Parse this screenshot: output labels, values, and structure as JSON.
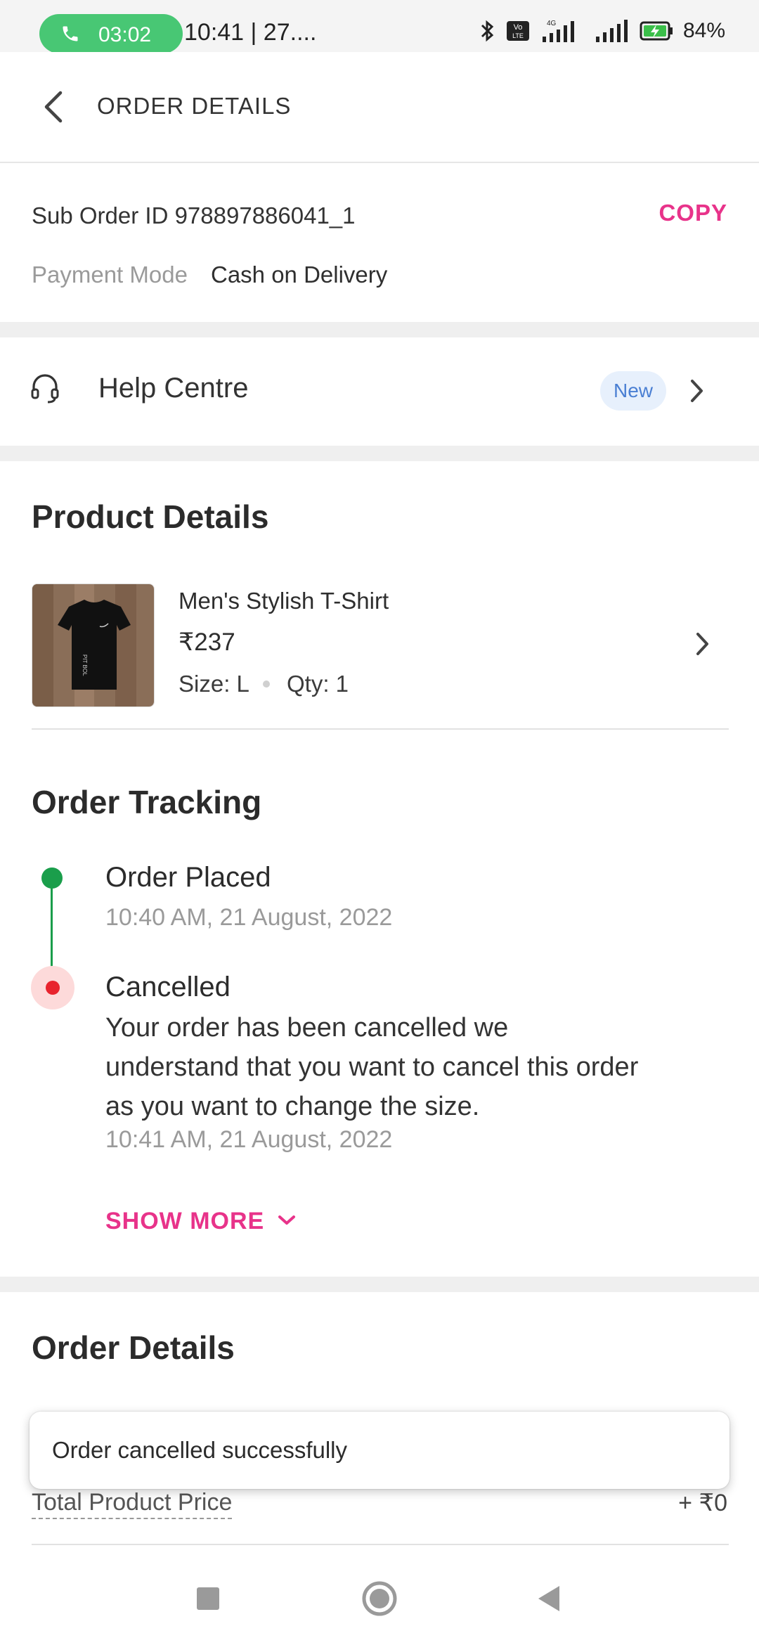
{
  "status_bar": {
    "call_timer": "03:02",
    "time_date": "10:41 | 27....",
    "battery": "84"
  },
  "header": {
    "title": "ORDER DETAILS"
  },
  "suborder": {
    "id_text": "Sub Order ID 978897886041_1",
    "copy_label": "COPY",
    "payment_label": "Payment Mode",
    "payment_value": "Cash on Delivery"
  },
  "help": {
    "label": "Help Centre",
    "badge": "New"
  },
  "product": {
    "heading": "Product Details",
    "name": "Men's Stylish T-Shirt",
    "price": "₹237",
    "size": "Size: L",
    "qty": "Qty: 1"
  },
  "tracking": {
    "heading": "Order Tracking",
    "steps": [
      {
        "title": "Order Placed",
        "time": "10:40 AM, 21 August, 2022"
      },
      {
        "title": "Cancelled",
        "description": "Your order has been cancelled we understand that you want to cancel this order as you want to change the size.",
        "time": "10:41 AM, 21 August, 2022"
      }
    ],
    "show_more": "SHOW MORE"
  },
  "order_details": {
    "heading": "Order Details",
    "total_label": "Total Product Price",
    "total_value": "+ ₹0"
  },
  "toast": {
    "message": "Order cancelled successfully"
  },
  "colors": {
    "accent_pink": "#e8338a",
    "call_green": "#48c774",
    "track_green": "#1a9e4b",
    "cancel_red": "#e8242e",
    "badge_blue": "#4a7fd3"
  }
}
